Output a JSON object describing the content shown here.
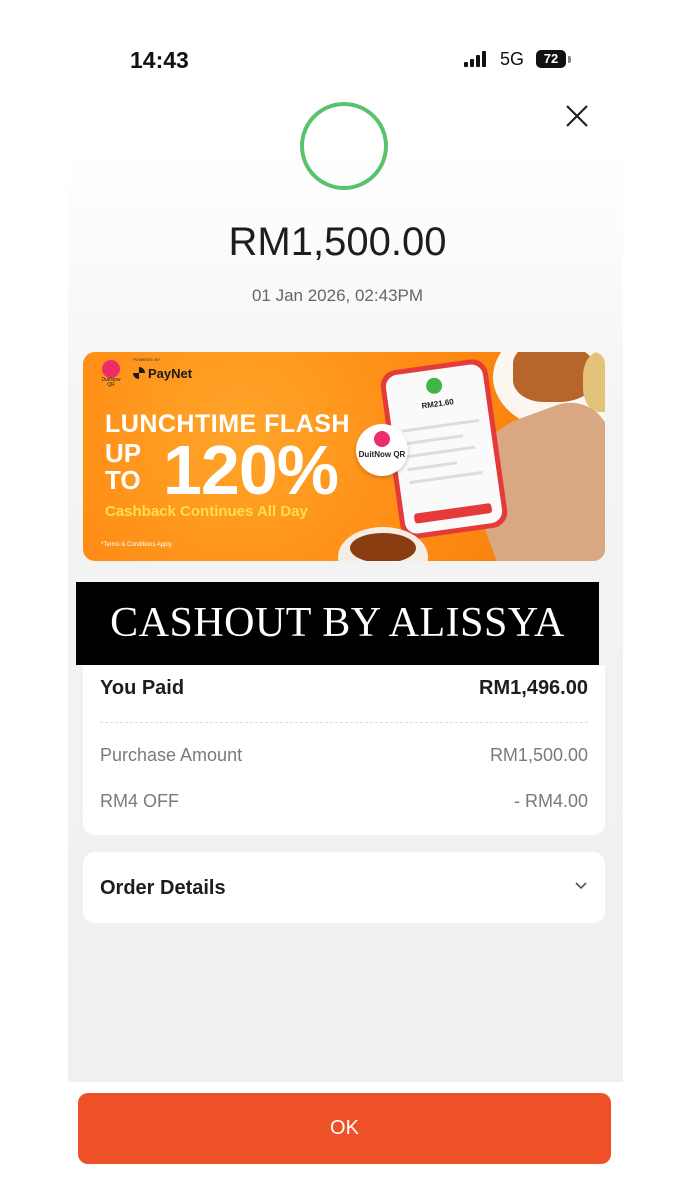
{
  "status_bar": {
    "time": "14:43",
    "network": "5G",
    "battery": "72"
  },
  "header": {
    "close_icon": "close-icon",
    "status_icon": "success-ring"
  },
  "transaction": {
    "amount": "RM1,500.00",
    "datetime": "01 Jan 2026, 02:43PM"
  },
  "promo_banner": {
    "powered_by": "POWERED BY",
    "brand": "PayNet",
    "duitnow_small": "DuitNow QR",
    "headline": "LUNCHTIME FLASH",
    "up_to": "UP TO",
    "percent": "120%",
    "subtitle": "Cashback Continues All Day",
    "terms": "*Terms & Conditions Apply.",
    "badge_text": "DuitNow QR",
    "phone_amount": "RM21.60",
    "accent_color": "#ff8c14"
  },
  "watermark": {
    "text": "CASHOUT BY ALISSYA"
  },
  "summary": {
    "paid_label": "You Paid",
    "paid_value": "RM1,496.00",
    "items": [
      {
        "label": "Purchase Amount",
        "value": "RM1,500.00"
      },
      {
        "label": "RM4 OFF",
        "value": "- RM4.00"
      }
    ]
  },
  "order_details": {
    "label": "Order Details",
    "icon": "chevron-down-icon"
  },
  "footer": {
    "ok_label": "OK",
    "button_color": "#ee5128"
  }
}
